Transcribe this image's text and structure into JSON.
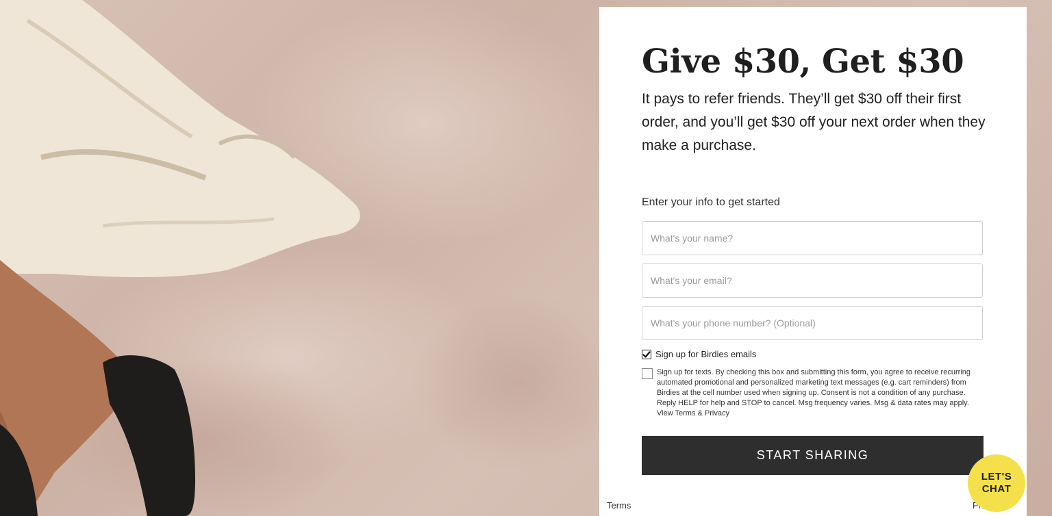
{
  "hero": {
    "title": "Give $30, Get $30",
    "subtitle": "It pays to refer friends. They’ll get $30 off their first order, and you’ll get $30 off your next order when they make a purchase."
  },
  "form": {
    "label": "Enter your info to get started",
    "name_placeholder": "What's your name?",
    "email_placeholder": "What's your email?",
    "phone_placeholder": "What's your phone number? (Optional)",
    "email_optin_label": "Sign up for Birdies emails",
    "email_optin_checked": true,
    "sms_optin_text": "Sign up for texts. By checking this box and submitting this form, you agree to receive recurring automated promotional and personalized marketing text messages (e.g. cart reminders) from Birdies at the cell number used when signing up. Consent is not a condition of any purchase. Reply HELP for help and STOP to cancel. Msg frequency varies. Msg & data rates may apply. View Terms & Privacy",
    "sms_optin_checked": false,
    "submit_label": "START SHARING"
  },
  "footer": {
    "terms_label": "Terms",
    "privacy_label": "Privacy"
  },
  "chat": {
    "label": "LET'S CHAT"
  },
  "colors": {
    "button_bg": "#2e2e2e",
    "chat_bg": "#f4e04a",
    "background": "#d3bbb0"
  }
}
